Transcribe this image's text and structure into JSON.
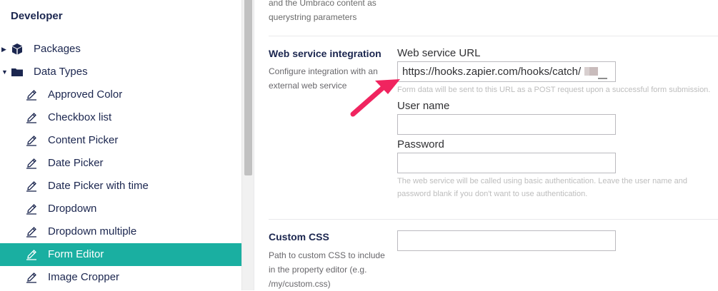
{
  "sidebar": {
    "title": "Developer",
    "items": [
      {
        "label": "Packages",
        "icon": "package-icon",
        "level": 0,
        "expanded": false,
        "active": false
      },
      {
        "label": "Data Types",
        "icon": "folder-icon",
        "level": 0,
        "expanded": true,
        "active": false
      },
      {
        "label": "Approved Color",
        "icon": "edit-icon",
        "level": 1,
        "active": false
      },
      {
        "label": "Checkbox list",
        "icon": "edit-icon",
        "level": 1,
        "active": false
      },
      {
        "label": "Content Picker",
        "icon": "edit-icon",
        "level": 1,
        "active": false
      },
      {
        "label": "Date Picker",
        "icon": "edit-icon",
        "level": 1,
        "active": false
      },
      {
        "label": "Date Picker with time",
        "icon": "edit-icon",
        "level": 1,
        "active": false
      },
      {
        "label": "Dropdown",
        "icon": "edit-icon",
        "level": 1,
        "active": false
      },
      {
        "label": "Dropdown multiple",
        "icon": "edit-icon",
        "level": 1,
        "active": false
      },
      {
        "label": "Form Editor",
        "icon": "edit-icon",
        "level": 1,
        "active": true
      },
      {
        "label": "Image Cropper",
        "icon": "edit-icon",
        "level": 1,
        "active": false
      }
    ]
  },
  "main": {
    "top_desc": "and the Umbraco content as querystring parameters",
    "web_service": {
      "title": "Web service integration",
      "description": "Configure integration with an external web service",
      "url_label": "Web service URL",
      "url_value": "https://hooks.zapier.com/hooks/catch/",
      "url_help": "Form data will be sent to this URL as a POST request upon a successful form submission.",
      "username_label": "User name",
      "username_value": "",
      "password_label": "Password",
      "password_value": "",
      "auth_help": "The web service will be called using basic authentication. Leave the user name and password blank if you don't want to use authentication."
    },
    "custom_css": {
      "title": "Custom CSS",
      "description": "Path to custom CSS to include in the property editor (e.g. /my/custom.css)",
      "value": ""
    }
  },
  "colors": {
    "active_item_bg": "#1aafa1",
    "arrow": "#f0245f",
    "text_primary": "#1b264f"
  }
}
